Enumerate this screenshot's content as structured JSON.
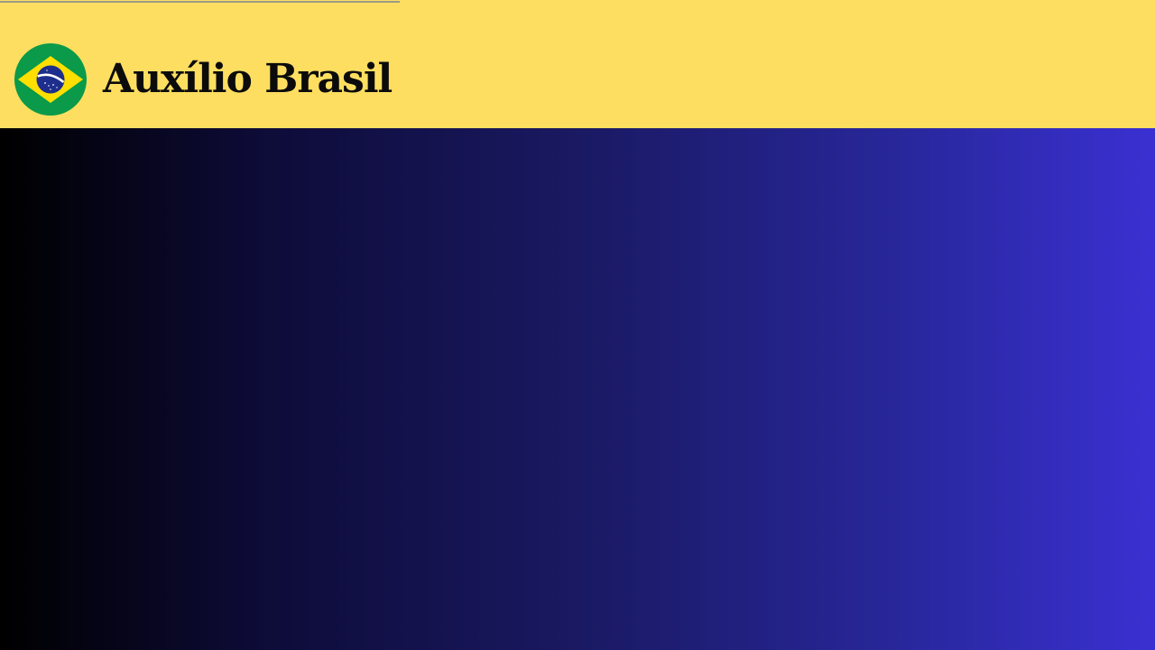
{
  "header": {
    "title": "Auxílio Brasil",
    "logo_icon": "brazil-flag-icon",
    "background_color": "#FEDE60"
  },
  "hero": {
    "gradient_start": "#000000",
    "gradient_end": "#3A30D2"
  }
}
